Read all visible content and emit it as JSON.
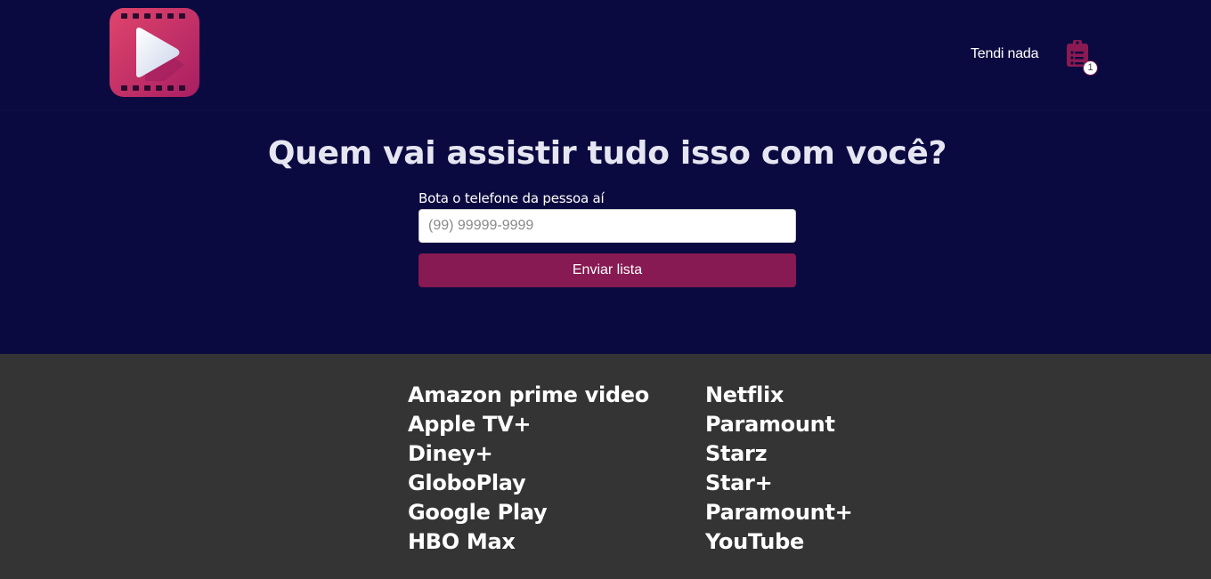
{
  "header": {
    "nav_link": "Tendi nada",
    "list_badge_count": "1",
    "colors": {
      "background": "#0b0a40",
      "logo_gradient_start": "#d63a6a",
      "logo_gradient_end": "#a21f63",
      "list_icon": "#8b1a52"
    }
  },
  "main": {
    "title": "Quem vai assistir tudo isso com você?",
    "phone_label": "Bota o telefone da pessoa aí",
    "phone_placeholder": "(99) 99999-9999",
    "phone_value": "",
    "submit_label": "Enviar lista",
    "colors": {
      "button": "#871a52"
    }
  },
  "footer": {
    "left_links": [
      "Amazon prime video",
      "Apple TV+",
      "Diney+",
      "GloboPlay",
      "Google Play",
      "HBO Max"
    ],
    "right_links": [
      "Netflix",
      "Paramount",
      "Starz",
      "Star+",
      "Paramount+",
      "YouTube"
    ],
    "colors": {
      "background": "#343434"
    }
  }
}
